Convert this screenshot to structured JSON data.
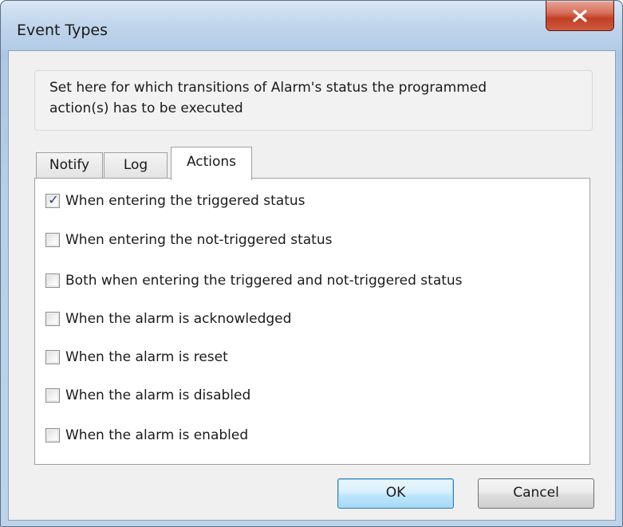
{
  "window": {
    "title": "Event Types",
    "close_symbol": "x"
  },
  "info": {
    "text_line1": "Set here for which transitions of Alarm's status the programmed",
    "text_line2": "action(s) has to be executed"
  },
  "tabs": [
    {
      "label": "Notify",
      "selected": false
    },
    {
      "label": "Log",
      "selected": false
    },
    {
      "label": "Actions",
      "selected": true
    }
  ],
  "options": [
    {
      "label": "When entering the triggered status",
      "checked": true
    },
    {
      "label": "When entering the not-triggered status",
      "checked": false
    },
    {
      "label": "Both when entering the triggered and not-triggered status",
      "checked": false
    },
    {
      "label": "When the alarm is acknowledged",
      "checked": false
    },
    {
      "label": "When the alarm is reset",
      "checked": false
    },
    {
      "label": "When the alarm is disabled",
      "checked": false
    },
    {
      "label": "When the alarm is enabled",
      "checked": false
    }
  ],
  "buttons": {
    "ok_label": "OK",
    "cancel_label": "Cancel"
  },
  "icons": {
    "close": "close-icon",
    "check": "checkmark-icon"
  },
  "colors": {
    "close_button": "#c13f24",
    "checkmark": "#2b3a7a",
    "default_button_border": "#3c7fb1"
  }
}
